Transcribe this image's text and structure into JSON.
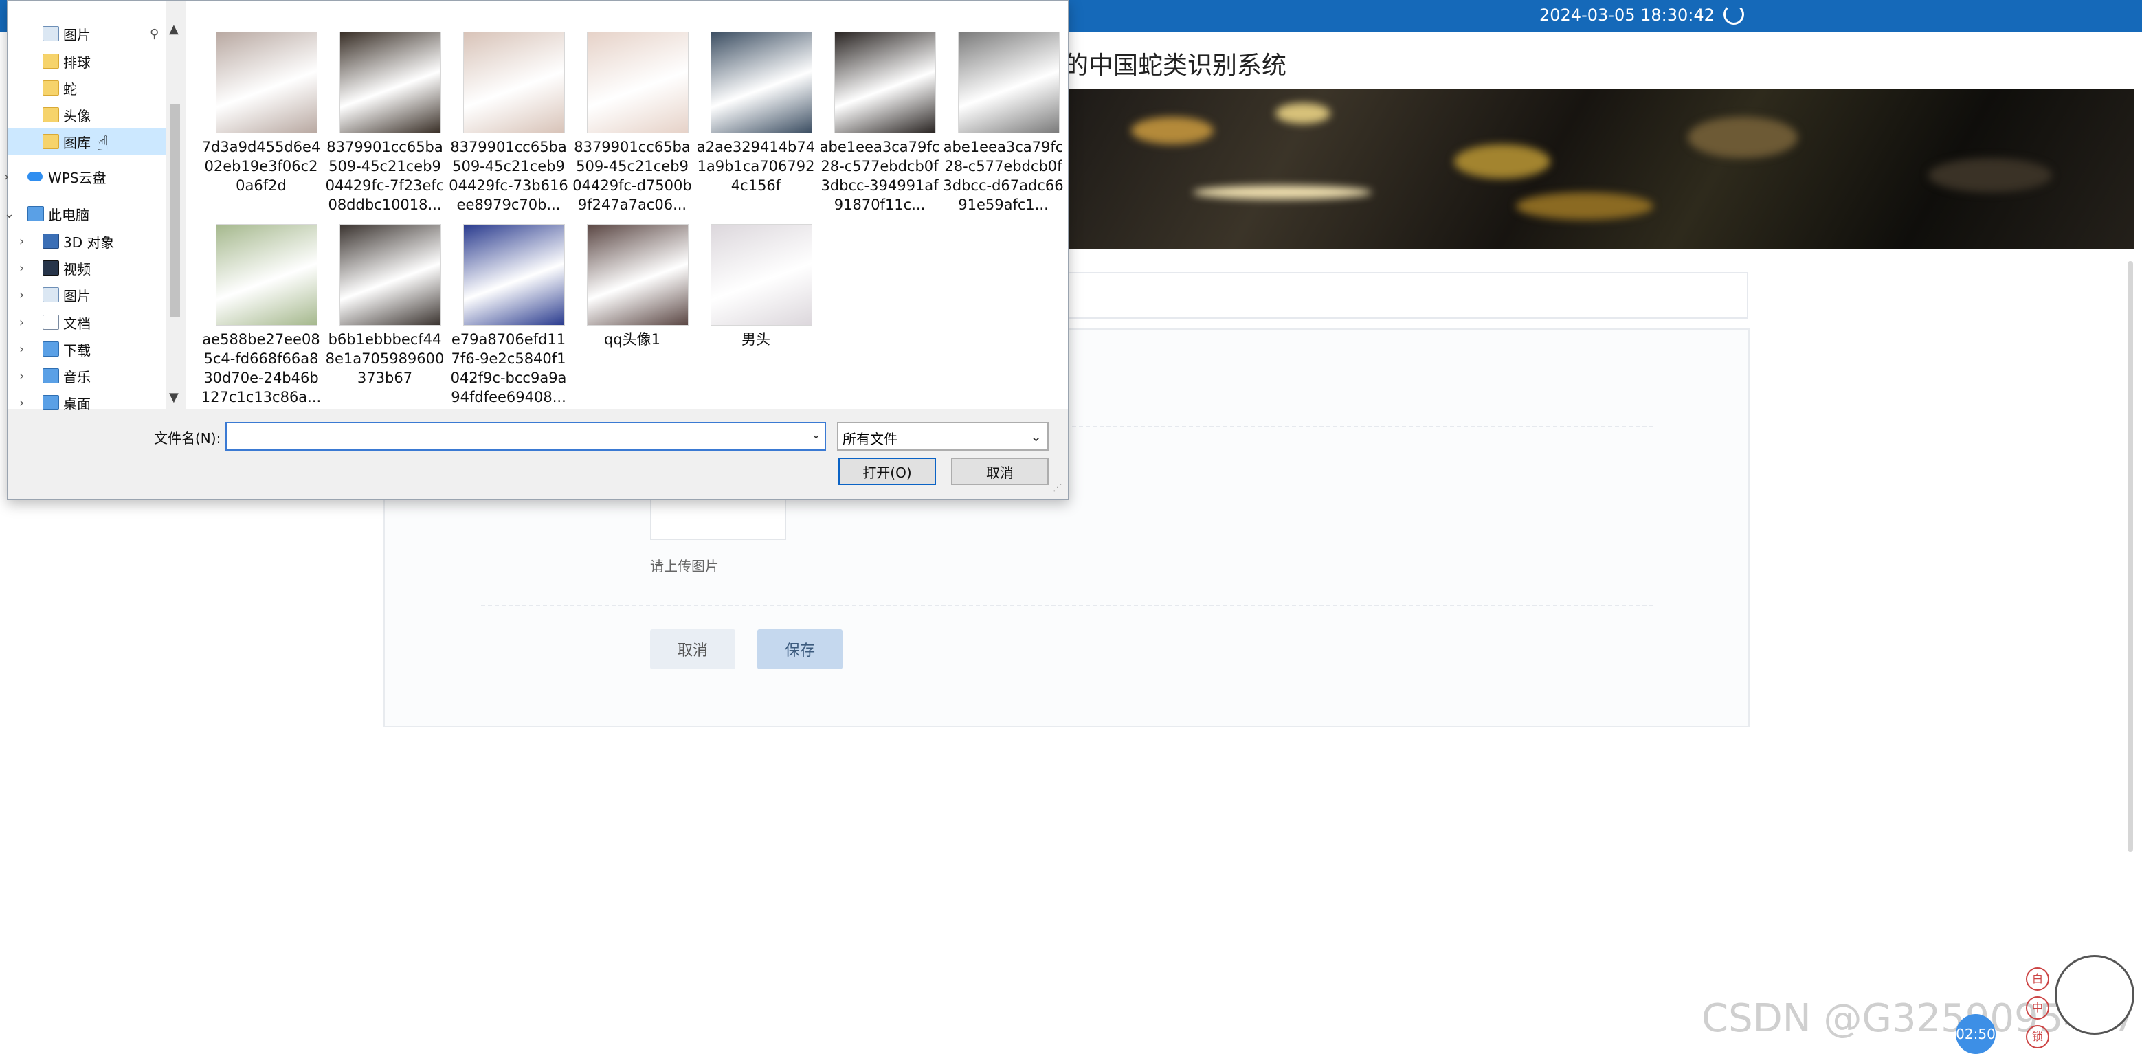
{
  "web": {
    "datetime": "2024-03-05   18:30:42",
    "system_title": "的中国蛇类识别系统",
    "upload_hint": "请上传图片",
    "cancel_label": "取消",
    "save_label": "保存",
    "watermark": "CSDN @G3259095417",
    "timer": "02:50",
    "mascot_icons": [
      "白",
      "中",
      "锁"
    ]
  },
  "dialog": {
    "nav": [
      {
        "label": "图片",
        "type": "pic",
        "pinned": true
      },
      {
        "label": "排球",
        "type": "folder"
      },
      {
        "label": "蛇",
        "type": "folder"
      },
      {
        "label": "头像",
        "type": "folder"
      },
      {
        "label": "图库",
        "type": "folder",
        "selected": true
      },
      {
        "label": "WPS云盘",
        "type": "cloud",
        "expandable": true
      },
      {
        "label": "此电脑",
        "type": "pc",
        "expanded": true
      },
      {
        "label": "3D 对象",
        "type": "cube",
        "expandable": true
      },
      {
        "label": "视频",
        "type": "video",
        "expandable": true
      },
      {
        "label": "图片",
        "type": "pic",
        "expandable": true
      },
      {
        "label": "文档",
        "type": "doc",
        "expandable": true
      },
      {
        "label": "下载",
        "type": "download",
        "expandable": true
      },
      {
        "label": "音乐",
        "type": "music",
        "expandable": true
      },
      {
        "label": "桌面",
        "type": "desktop",
        "expandable": true
      }
    ],
    "files": [
      {
        "name": "7d3a9d455d6e402eb19e3f06c20a6f2d"
      },
      {
        "name": "8379901cc65ba509-45c21ceb904429fc-7f23efc08ddbc10018..."
      },
      {
        "name": "8379901cc65ba509-45c21ceb904429fc-73b616ee8979c70b..."
      },
      {
        "name": "8379901cc65ba509-45c21ceb904429fc-d7500b9f247a7ac06..."
      },
      {
        "name": "a2ae329414b741a9b1ca7067924c156f"
      },
      {
        "name": "abe1eea3ca79fc28-c577ebdcb0f3dbcc-394991af91870f11c..."
      },
      {
        "name": "abe1eea3ca79fc28-c577ebdcb0f3dbcc-d67adc6691e59afc1..."
      },
      {
        "name": "ae588be27ee085c4-fd668f66a830d70e-24b46b127c1c13c86a..."
      },
      {
        "name": "b6b1ebbbecf448e1a705989600373b67"
      },
      {
        "name": "e79a8706efd117f6-9e2c5840f1042f9c-bcc9a9a94fdfee69408..."
      },
      {
        "name": "qq头像1"
      },
      {
        "name": "男头"
      }
    ],
    "filename_label": "文件名(N):",
    "filename_value": "",
    "filetype_value": "所有文件",
    "open_label": "打开(O)",
    "cancel_label": "取消"
  }
}
